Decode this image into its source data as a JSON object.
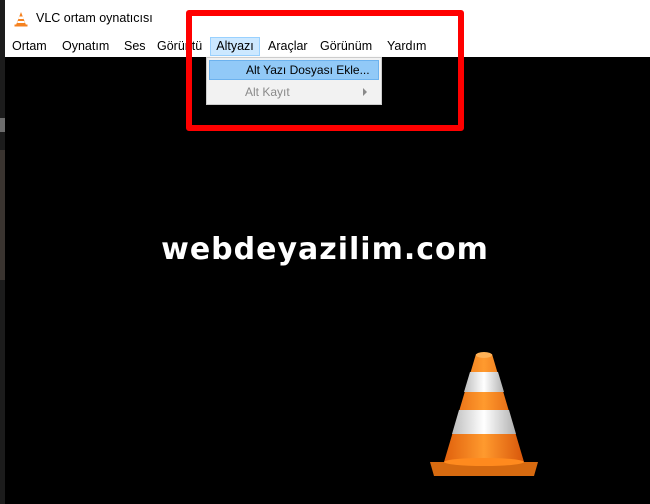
{
  "window": {
    "title": "VLC ortam oynatıcısı",
    "icon": "vlc-cone-icon"
  },
  "menubar": {
    "items": [
      {
        "label": "Ortam"
      },
      {
        "label": "Oynatım"
      },
      {
        "label": "Ses"
      },
      {
        "label": "Görüntü"
      },
      {
        "label": "Altyazı",
        "active": true
      },
      {
        "label": "Araçlar"
      },
      {
        "label": "Görünüm"
      },
      {
        "label": "Yardım"
      }
    ]
  },
  "dropdown": {
    "items": [
      {
        "label": "Alt Yazı Dosyası Ekle...",
        "highlighted": true
      },
      {
        "label": "Alt Kayıt",
        "disabled": true,
        "submenu": true
      }
    ]
  },
  "video": {
    "watermark": "webdeyazilim.com",
    "logo": "vlc-cone-logo"
  },
  "colors": {
    "highlight_frame": "#ff0000",
    "menu_hover": "#cce8ff",
    "dropdown_highlight": "#91c9f7",
    "cone_orange": "#f58220"
  }
}
